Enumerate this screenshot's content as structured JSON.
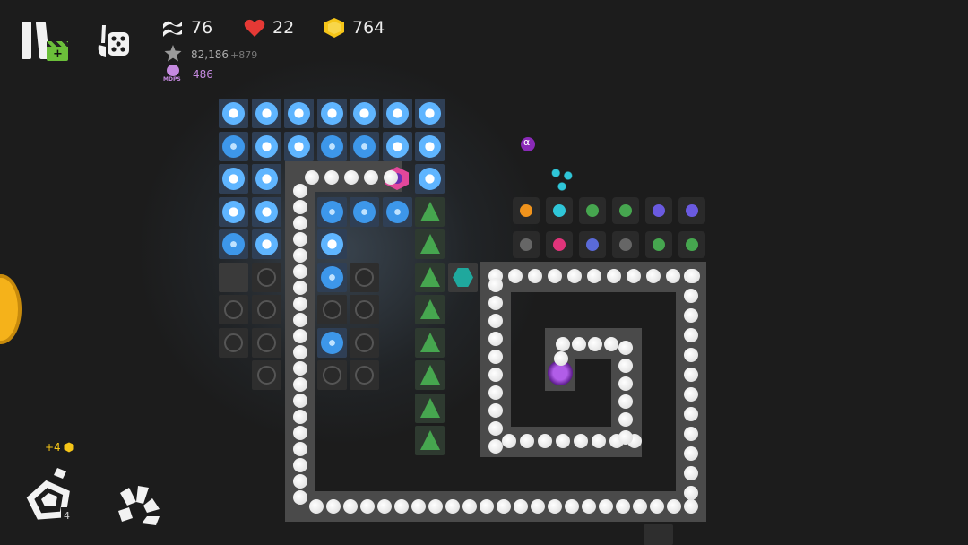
{
  "hud": {
    "wave": "76",
    "lives": "22",
    "coins": "764",
    "score": "82,186",
    "score_delta": "+879",
    "mdps_label": "MDPS",
    "mdps": "486"
  },
  "bottom": {
    "coin_bonus": "+4",
    "ability_count": "4"
  },
  "colors": {
    "heart": "#e53935",
    "coin": "#f5c518",
    "mdps": "#c58ae0",
    "tower_blue": "#3d97ea",
    "tower_green": "#46a64f"
  },
  "icons": {
    "pause": "pause-icon",
    "replay": "replay-clapperboard-icon",
    "draw": "palette-dice-icon",
    "wave": "wave-icon",
    "heart": "heart-icon",
    "coin": "coin-icon",
    "star": "star-icon",
    "mdps": "mdps-icon"
  }
}
